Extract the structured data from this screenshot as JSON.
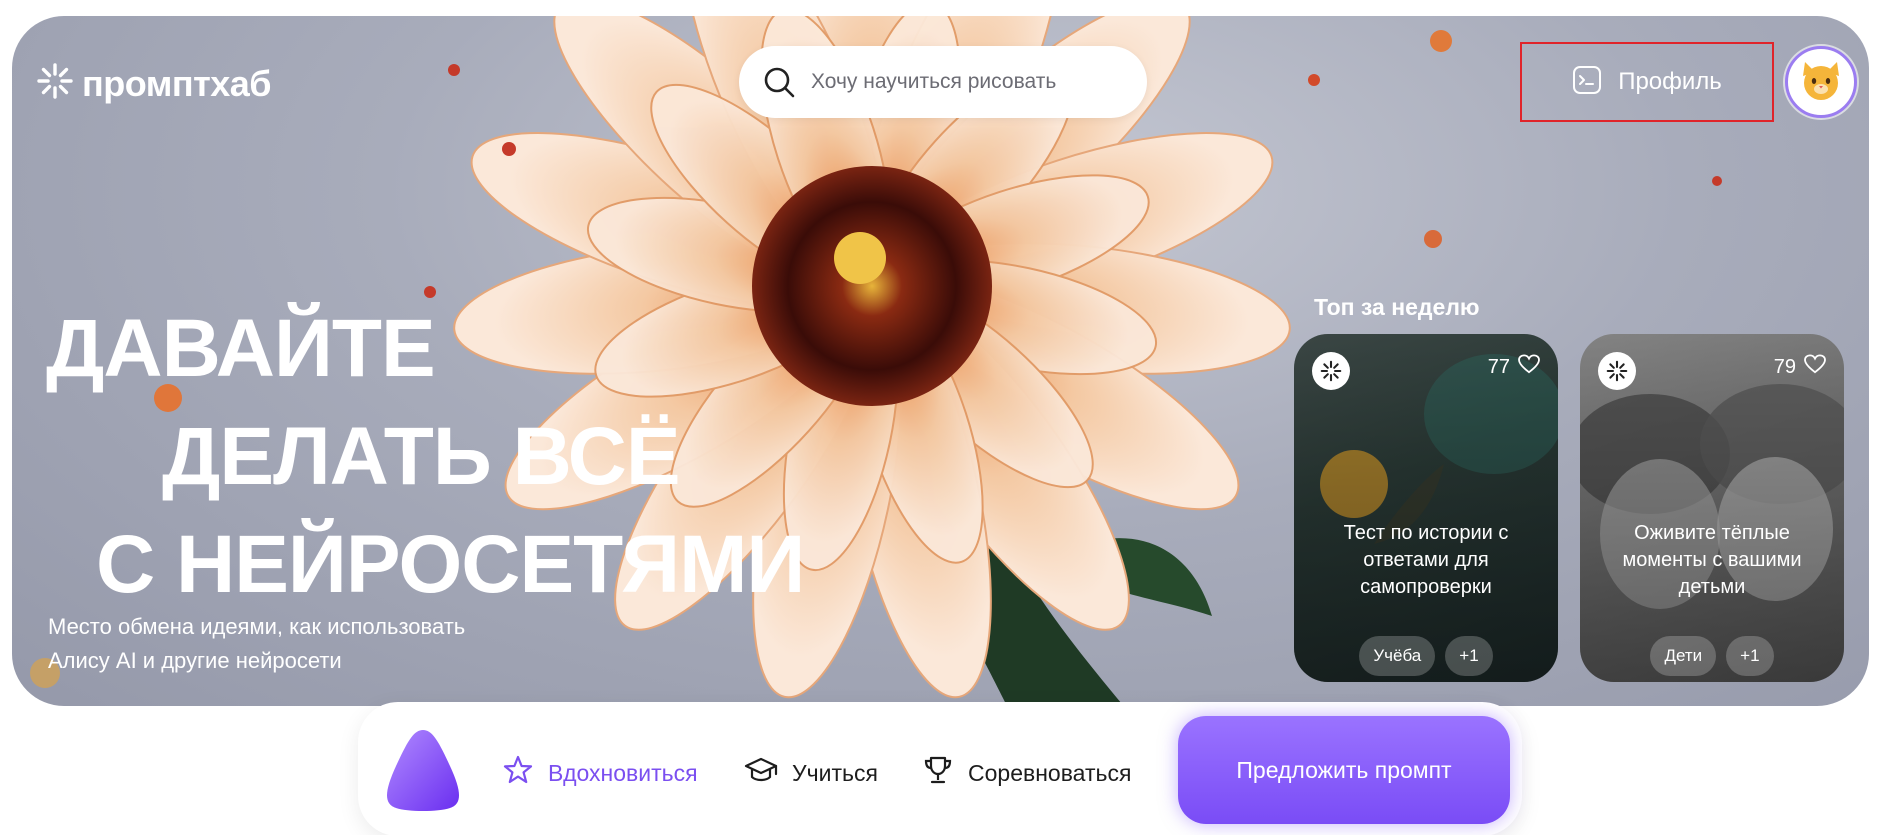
{
  "brand": {
    "name": "промптхаб"
  },
  "search": {
    "placeholder": "Хочу научиться рисовать"
  },
  "header": {
    "profile_label": "Профиль"
  },
  "hero": {
    "headline_lines": [
      "ДАВАЙТЕ",
      "ДЕЛАТЬ ВСЁ",
      "С НЕЙРОСЕТЯМИ"
    ],
    "subtitle": "Место обмена идеями, как использовать Алису AI и другие нейросети"
  },
  "top_week": {
    "title": "Топ за неделю",
    "cards": [
      {
        "likes": "77",
        "text": "Тест по истории с ответами для самопроверки",
        "tags": [
          "Учёба",
          "+1"
        ]
      },
      {
        "likes": "79",
        "text": "Оживите тёплые моменты с вашими детьми",
        "tags": [
          "Дети",
          "+1"
        ]
      }
    ]
  },
  "nav": {
    "items": [
      {
        "label": "Вдохновиться",
        "icon": "star-icon",
        "active": true
      },
      {
        "label": "Учиться",
        "icon": "graduation-cap-icon",
        "active": false
      },
      {
        "label": "Соревноваться",
        "icon": "trophy-icon",
        "active": false
      }
    ],
    "cta_label": "Предложить промпт"
  },
  "colors": {
    "accent": "#7b4ff0",
    "highlight_border": "#e0242a"
  }
}
